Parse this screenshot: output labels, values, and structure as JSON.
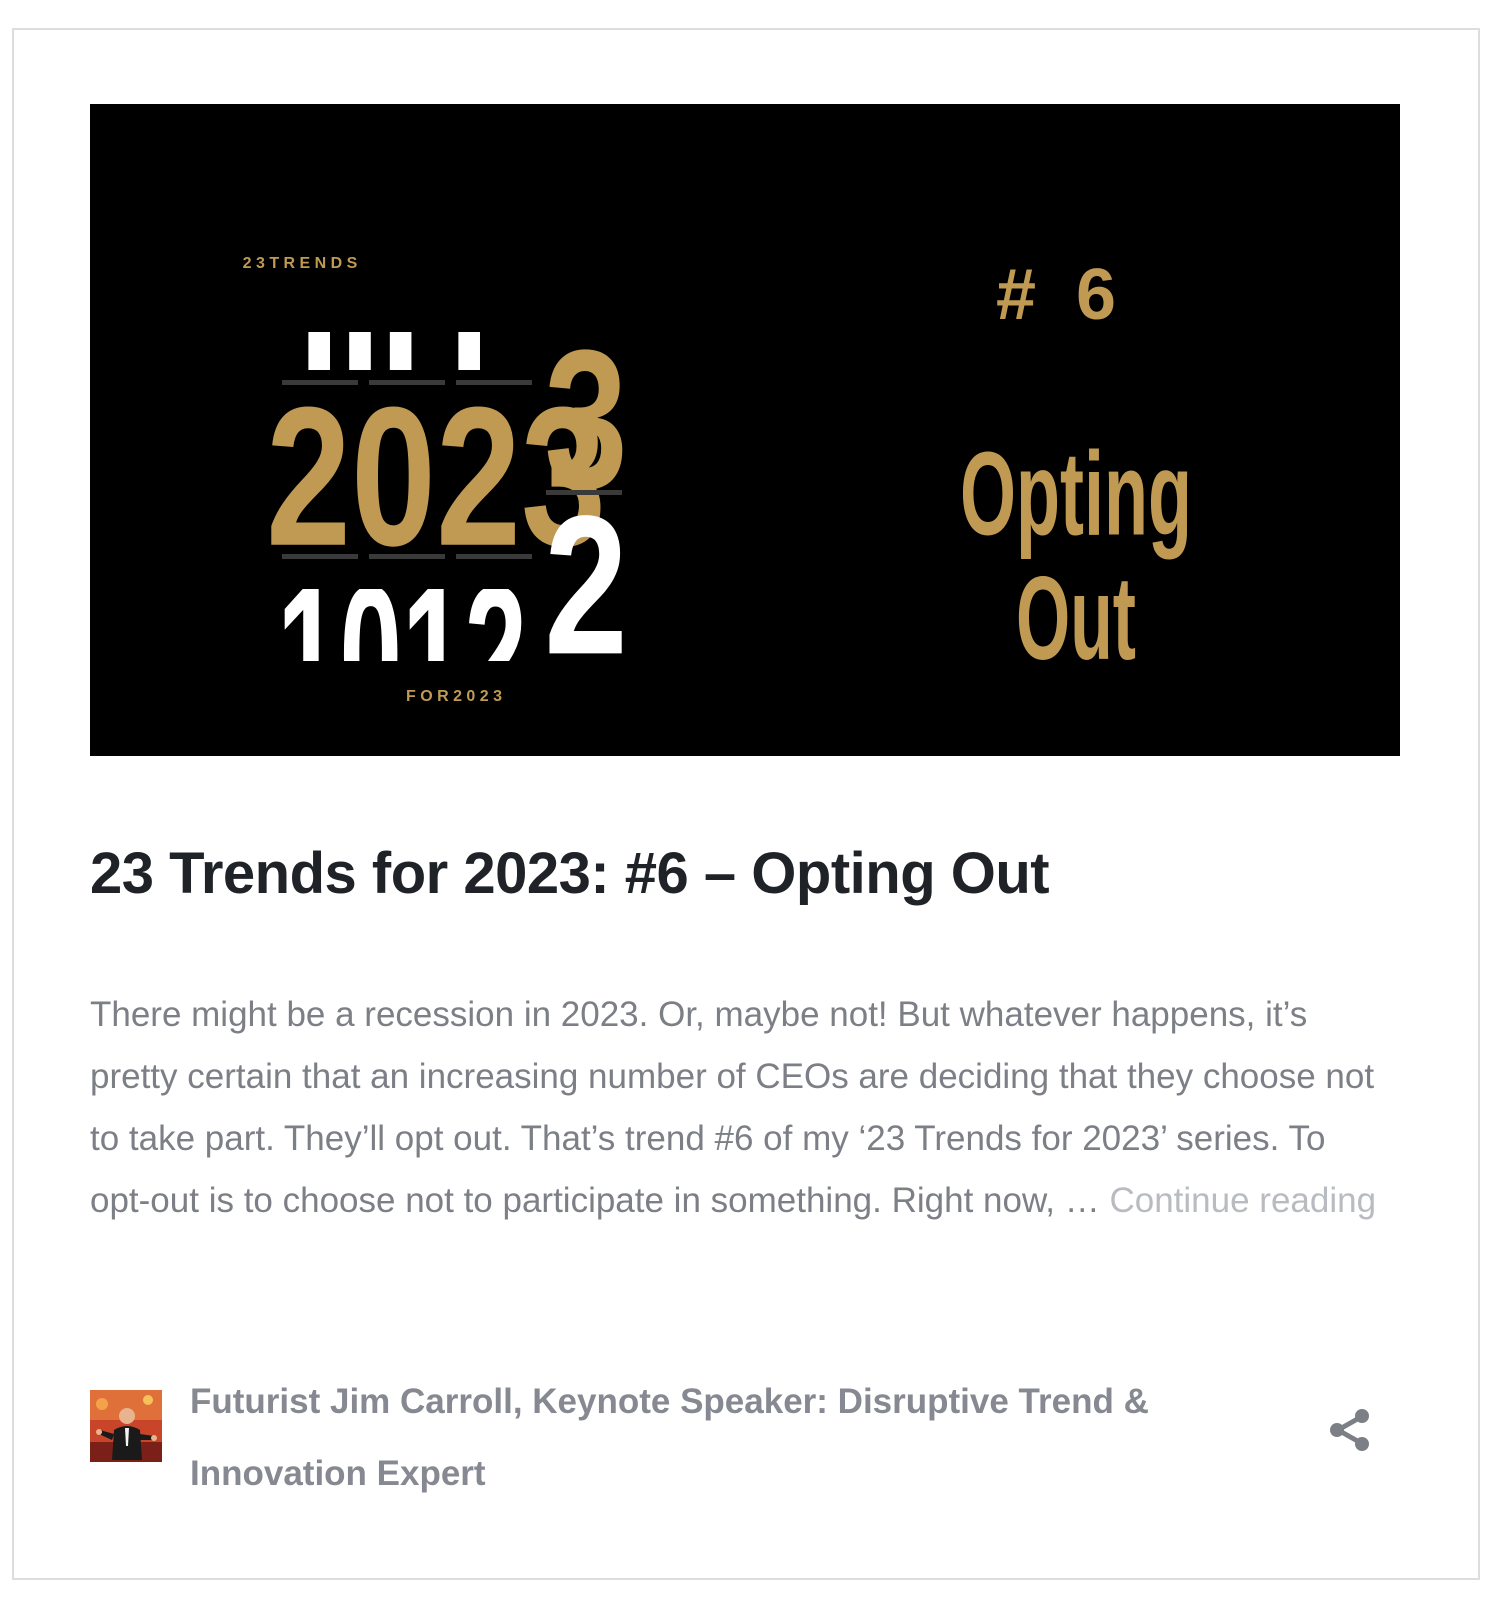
{
  "post": {
    "image": {
      "top_caption": "2 3   T R E N D S",
      "years": {
        "partial_top": "UIU",
        "main": "2023",
        "bottom": "1012"
      },
      "bottom_caption": "F O R   2 0 2 3",
      "trend_number": "#  6",
      "trend_name_line1": "Opting",
      "trend_name_line2": "Out"
    },
    "title": "23 Trends for 2023: #6 – Opting Out",
    "excerpt": "There might be a recession in 2023. Or, maybe not! But whatever happens, it’s pretty certain that an increasing number of CEOs are deciding that they choose not to take part. They’ll opt out. That’s trend #6 of my ‘23 Trends for 2023’ series. To opt-out is to choose not to participate in something. Right now, … ",
    "continue_label": "Continue reading"
  },
  "author": {
    "name": "Futurist Jim Carroll, Keynote Speaker: Disruptive Trend & Innovation Expert"
  },
  "icons": {
    "share": "share-icon",
    "avatar": "author-avatar"
  },
  "colors": {
    "gold": "#c09a52",
    "title": "#1f2328",
    "excerpt": "#7c7f86",
    "continue": "#b8bbbf",
    "author": "#868991",
    "border": "#dddddd"
  }
}
